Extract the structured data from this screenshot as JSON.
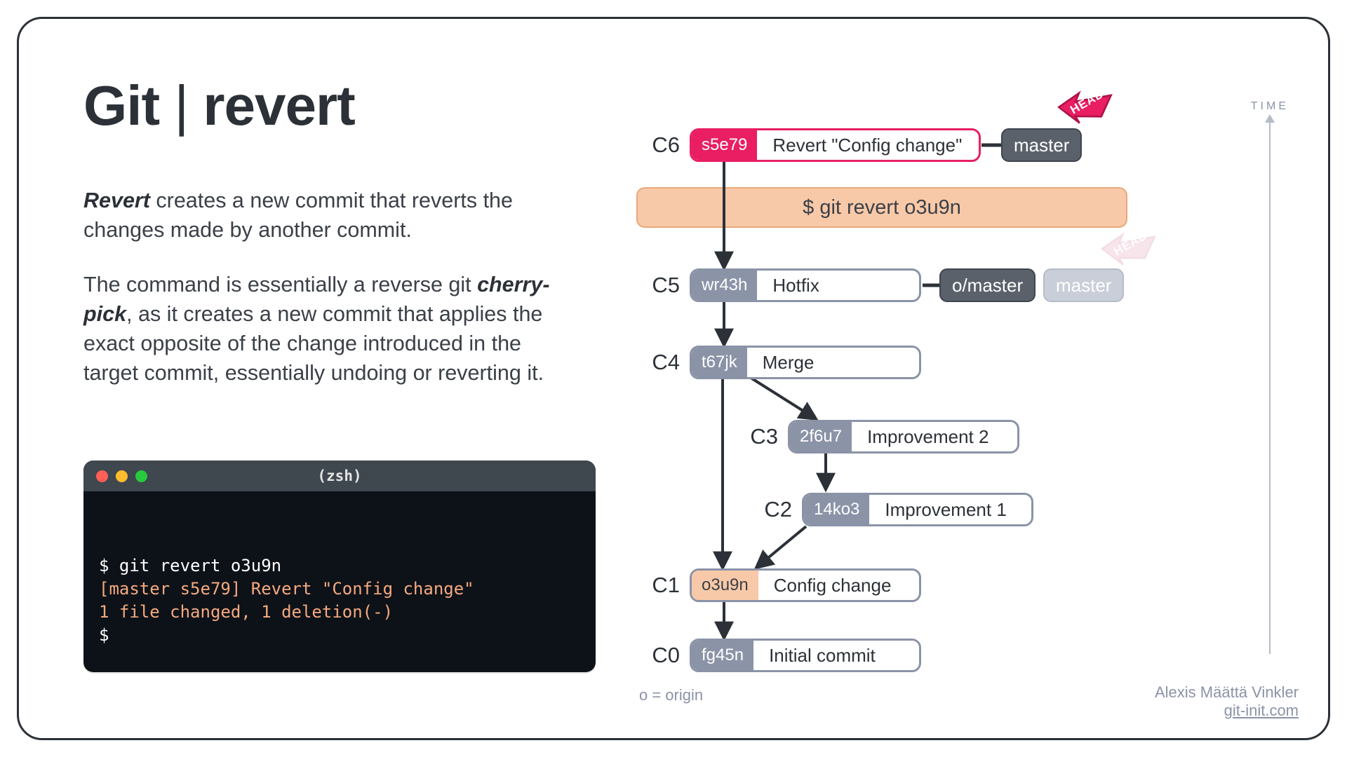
{
  "title": {
    "left": "Git",
    "sep": "|",
    "right": "revert"
  },
  "para1": {
    "lead": "Revert",
    "rest": " creates a new commit that reverts the changes made by another commit."
  },
  "para2": {
    "a": "The command is essentially a reverse git ",
    "b": "cherry-pick",
    "c": ", as it creates a new commit that applies the exact opposite of the change introduced in the target commit, essentially undoing or reverting it."
  },
  "terminal": {
    "title": "(zsh)",
    "l1": "$ git revert o3u9n",
    "l2": "[master s5e79] Revert \"Config change\"",
    "l3": "1 file changed, 1 deletion(-)",
    "l4": "$"
  },
  "cmdbar": "$ git revert o3u9n",
  "commits": {
    "c6": {
      "label": "C6",
      "hash": "s5e79",
      "msg": "Revert \"Config change\""
    },
    "c5": {
      "label": "C5",
      "hash": "wr43h",
      "msg": "Hotfix"
    },
    "c4": {
      "label": "C4",
      "hash": "t67jk",
      "msg": "Merge"
    },
    "c3": {
      "label": "C3",
      "hash": "2f6u7",
      "msg": "Improvement 2"
    },
    "c2": {
      "label": "C2",
      "hash": "14ko3",
      "msg": "Improvement 1"
    },
    "c1": {
      "label": "C1",
      "hash": "o3u9n",
      "msg": "Config change"
    },
    "c0": {
      "label": "C0",
      "hash": "fg45n",
      "msg": "Initial commit"
    }
  },
  "branches": {
    "master": "master",
    "omaster": "o/master",
    "master_faded": "master"
  },
  "head": "HEAD",
  "time": "TIME",
  "origin_note": "o = origin",
  "credit": {
    "name": "Alexis Määttä Vinkler",
    "site": "git-init.com"
  }
}
